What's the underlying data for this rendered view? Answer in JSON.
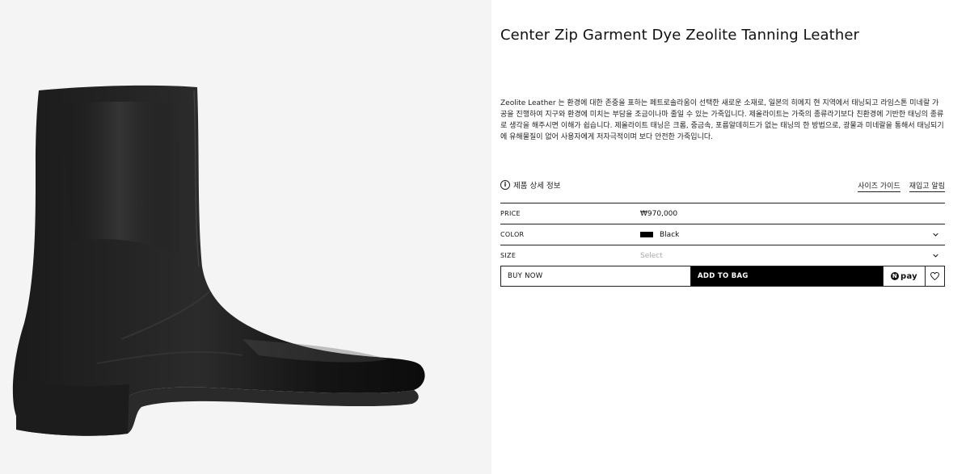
{
  "product": {
    "title": "Center Zip Garment Dye Zeolite Tanning Leather",
    "description": "Zeolite Leather 는 환경에 대한 존중을 표하는 페트로솔라움이 선택한 새로운 소재로, 일본의 히메지 현 지역에서 태닝되고 라임스톤 미네랄 가공을 진행하여 지구와 환경에 미치는 부담을 조금이나마 줄일 수 있는 가죽입니다. 제올라이트는 가죽의 종류라기보다 친환경에 기반한 태닝의 종류로 생각을 해주시면 이해가 쉽습니다. 제올라이트 태닝은 크롬, 중금속, 포름알데히드가 없는 태닝의 한 방법으로, 광물과 미네랄을 통해서 태닝되기에 유해물질이 없어 사용자에게 저자극적이며 보다 안전한 가죽입니다.",
    "detail_link": "제품 상세 정보",
    "size_guide": "사이즈 가이드",
    "restock_alert": "재입고 알림"
  },
  "options": {
    "price_label": "PRICE",
    "price_value": "₩970,000",
    "color_label": "COLOR",
    "color_value": "Black",
    "color_swatch": "#000000",
    "size_label": "SIZE",
    "size_placeholder": "Select"
  },
  "actions": {
    "buy_now": "BUY NOW",
    "add_to_bag": "ADD TO BAG",
    "pay_label": "pay",
    "pay_badge": "N"
  },
  "icons": {
    "info": "info-icon",
    "chevron": "chevron-down-icon",
    "wishlist": "heart-icon"
  }
}
